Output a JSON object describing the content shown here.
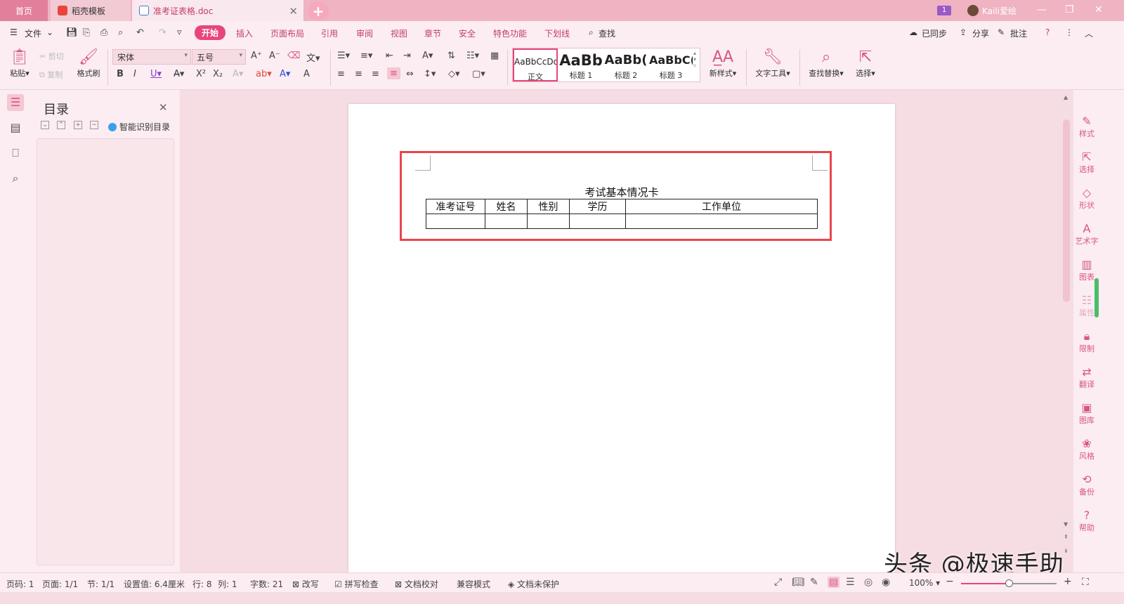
{
  "titlebar": {
    "tabs": [
      {
        "label": "首页"
      },
      {
        "label": "稻壳模板"
      },
      {
        "label": "准考证表格.doc"
      }
    ],
    "badge": "1",
    "user": "Kaili爱绘"
  },
  "menu": {
    "file": "文件",
    "items": [
      "开始",
      "插入",
      "页面布局",
      "引用",
      "审阅",
      "视图",
      "章节",
      "安全",
      "特色功能",
      "下划线"
    ],
    "search": "查找",
    "sync": "已同步",
    "share": "分享",
    "comment": "批注"
  },
  "ribbon": {
    "paste": "粘贴",
    "cut": "剪切",
    "copy": "复制",
    "format_painter": "格式刷",
    "font": "宋体",
    "font_size": "五号",
    "styles": [
      {
        "preview": "AaBbCcDd",
        "label": "正文"
      },
      {
        "preview": "AaBb",
        "label": "标题 1"
      },
      {
        "preview": "AaBb(",
        "label": "标题 2"
      },
      {
        "preview": "AaBbC(",
        "label": "标题 3"
      }
    ],
    "new_style": "新样式",
    "text_tools": "文字工具",
    "find_replace": "查找替换",
    "select": "选择"
  },
  "toc": {
    "title": "目录",
    "smart": "智能识别目录"
  },
  "document": {
    "title": "考试基本情况卡",
    "table": {
      "headers": [
        "准考证号",
        "姓名",
        "性别",
        "学历",
        "工作单位"
      ],
      "rows": [
        [
          "",
          "",
          "",
          "",
          ""
        ]
      ]
    }
  },
  "right_panel": {
    "items": [
      "样式",
      "选择",
      "形状",
      "艺术字",
      "图表",
      "属性",
      "限制",
      "翻译",
      "图库",
      "风格",
      "备份",
      "帮助"
    ]
  },
  "statusbar": {
    "page_num": "页码: 1",
    "pages": "页面: 1/1",
    "section": "节: 1/1",
    "setting": "设置值: 6.4厘米",
    "row": "行: 8",
    "col": "列: 1",
    "words": "字数: 21",
    "revise": "改写",
    "spell": "拼写检查",
    "proof": "文档校对",
    "compat": "兼容模式",
    "protect": "文档未保护",
    "zoom": "100%",
    "zoom_fraction": 0.5
  },
  "watermark": "头条 @极速手助",
  "colors": {
    "accent": "#e8467a",
    "highlight_box": "#e8464d",
    "titlebar": "#efb3c2"
  }
}
